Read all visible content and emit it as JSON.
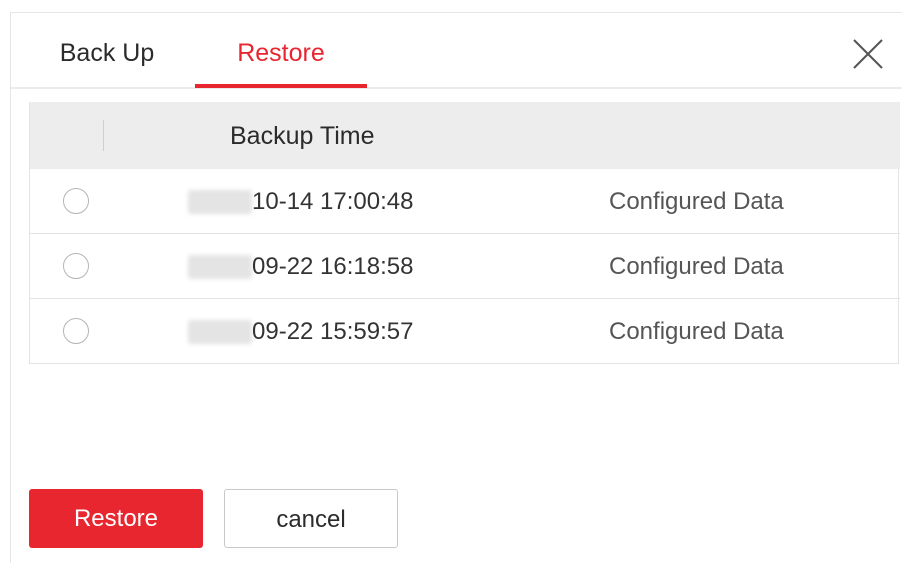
{
  "tabs": {
    "backup_label": "Back Up",
    "restore_label": "Restore",
    "active": "Restore"
  },
  "colors": {
    "accent": "#e8262f",
    "header_bg": "#ededed"
  },
  "table": {
    "header": "Backup Time",
    "rows": [
      {
        "time": "10-14 17:00:48",
        "type": "Configured Data",
        "selected": false
      },
      {
        "time": "09-22 16:18:58",
        "type": "Configured Data",
        "selected": false
      },
      {
        "time": "09-22 15:59:57",
        "type": "Configured Data",
        "selected": false
      }
    ]
  },
  "footer": {
    "restore_label": "Restore",
    "cancel_label": "cancel"
  }
}
